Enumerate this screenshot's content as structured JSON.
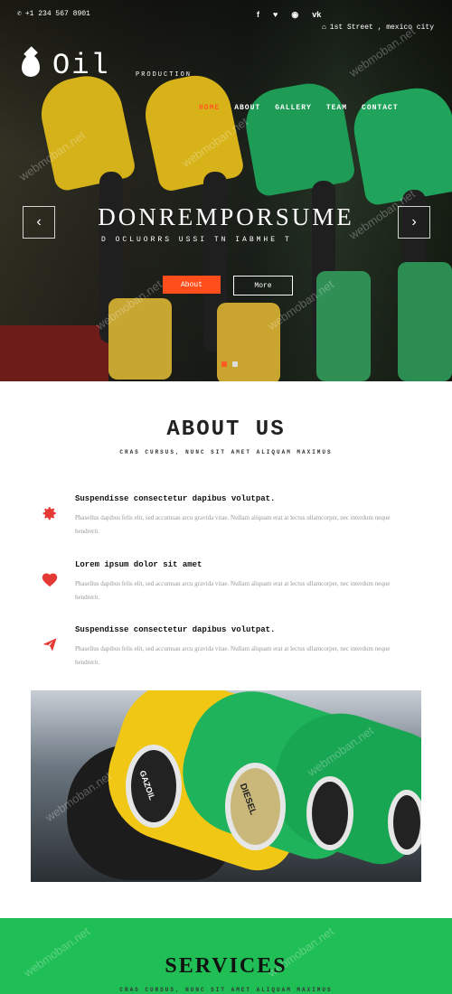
{
  "topbar": {
    "phone": "+1 234 567 8901",
    "social": [
      "f",
      "t",
      "rss",
      "vk"
    ],
    "address": "1st Street , mexico city"
  },
  "logo": {
    "name": "Oil",
    "tagline": "PRODUCTION"
  },
  "nav": {
    "items": [
      {
        "label": "HOME",
        "active": true
      },
      {
        "label": "ABOUT",
        "active": false
      },
      {
        "label": "GALLERY",
        "active": false
      },
      {
        "label": "TEAM",
        "active": false
      },
      {
        "label": "CONTACT",
        "active": false
      }
    ]
  },
  "hero": {
    "title": "DONREMPORSUME",
    "subtitle": "D OCLUORRS USSI TN IABMHE T",
    "buttons": {
      "primary": "About",
      "secondary": "More"
    },
    "prev_icon": "‹",
    "next_icon": "›",
    "slides_total": 2,
    "slide_active_index": 0
  },
  "about": {
    "title": "ABOUT US",
    "subtitle": "CRAS CURSUS, NUNC SIT AMET ALIQUAM MAXIMUS",
    "features": [
      {
        "icon": "gear-icon",
        "heading": "Suspendisse consectetur dapibus volutpat.",
        "text": "Phasellus dapibus felis elit, sed accumsan arcu gravida vitae. Nullam aliquam erat at lectus ullamcorper, nec interdum neque hendrerit."
      },
      {
        "icon": "heart-icon",
        "heading": "Lorem ipsum dolor sit amet",
        "text": "Phasellus dapibus felis elit, sed accumsan arcu gravida vitae. Nullam aliquam erat at lectus ullamcorper, nec interdum neque hendrerit."
      },
      {
        "icon": "paper-plane-icon",
        "heading": "Suspendisse consectetur dapibus volutpat.",
        "text": "Phasellus dapibus felis elit, sed accumsan arcu gravida vitae. Nullam aliquam erat at lectus ullamcorper, nec interdum neque hendrerit."
      }
    ]
  },
  "photo": {
    "labels": [
      "GAZOIL",
      "DIESEL"
    ]
  },
  "services": {
    "title": "SERVICES",
    "subtitle": "CRAS CURSUS, NUNC SIT AMET ALIQUAM MAXIMUS"
  },
  "watermark": "webmoban.net",
  "colors": {
    "accent": "#ff5a1f",
    "icon_red": "#e53935",
    "services_green": "#20bf55"
  }
}
